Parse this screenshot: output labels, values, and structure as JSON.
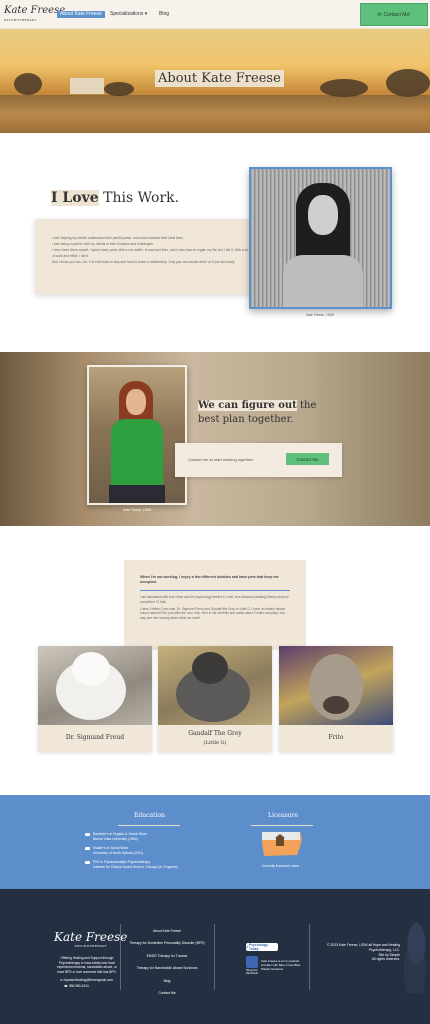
{
  "header": {
    "logo_text": "Kate Freese",
    "logo_sub": "PSYCHOTHERAPY",
    "nav": {
      "about": "About Kate Freese",
      "specializations": "Specializations",
      "blog": "Blog"
    },
    "cta_label": "Contact Me!"
  },
  "hero": {
    "title": "About Kate Freese"
  },
  "love": {
    "title_highlight": "I Love",
    "title_rest": "This Work.",
    "paragraphs": [
      "I love helping my clients understand their painful pasts, and move towards their ideal lives.",
      "I love being a partner with my clients in their triumphs and challenges.",
      "I have been there myself. I spent many years with a non-battle. It was hard then, and it was hard to regain my life, but I did it. With a lot of work and effort, I did it.",
      "And I know you can, too. It is both hard to stay and hard to leave a relationship. Only you can decide when or if you are ready."
    ],
    "photo_caption": "Kate Freese, LISW"
  },
  "plan": {
    "title_highlight": "We can figure out",
    "title_rest": "the best plan together.",
    "contact_prompt": "Contact me to start working together!",
    "button_label": "Contact Me",
    "photo_caption": "Kate Freese, LISW"
  },
  "hobbies": {
    "heading": "When I'm not working, I enjoy a few different hobbies and have pets that keep me occupied.",
    "paragraphs": [
      "I am fascinated with true crime and the psychology behind it. I knit, love diamond painting Disney and just completed 71 Mail.",
      "I have 3 feline Conn cats. Dr. Sigmund Freud and Gandalf the Grey or Little G. I have an elderly basset hound named Frito, just after the corn chip. He's in his old feltie and walks about 2 miles everyday! You may see him moving about while we meet!"
    ],
    "pets": [
      {
        "name": "Dr. Sigmund Freud",
        "sub": ""
      },
      {
        "name": "Gandalf The Grey",
        "sub": "(Little G)"
      },
      {
        "name": "Frito",
        "sub": ""
      }
    ]
  },
  "education": {
    "heading": "Education",
    "items": [
      {
        "line1": "Bachelor's in English & Social Work",
        "line2": "Buena Vista University (1984)"
      },
      {
        "line1": "Master's in Social Work",
        "line2": "University of North Dakota (2021)"
      },
      {
        "line1": "PhD in Psychoanalytic Psychotherapy",
        "line2": "Institute for Clinical Social Work in Chicago (in Progress)"
      }
    ]
  },
  "licensure": {
    "heading": "Licensure",
    "caption": "Currently licensed in Iowa."
  },
  "footer": {
    "logo_text": "Kate Freese",
    "logo_sub": "PSYCHOTHERAPY",
    "description": "Offering Healing and Support through Psychotherapy in Iowa Adults who have experienced trauma, narcissistic abuse, or have BPD or love someone that has BPD.",
    "email": "hopeandhealing@frheesgmail.com",
    "phone": "396-980-4314",
    "links": [
      "About Kate Freese",
      "Therapy for Borderline Personality Disorder (BPD)",
      "EMDR Therapy for Trauma",
      "Therapy for Narcissistic Abuse Survivors",
      "Blog",
      "Contact Me"
    ],
    "badge": "Verified by Psychology Today",
    "badge_short": "Psychology Today",
    "bcbs_caption": "BlueCross BlueShield",
    "bcbs_text": "Kate Freese is an in-network provider with Blue Cross Blue Shield insurance.",
    "copyright": "© 2023 Kate Freese, LISW all Hope and Healing Psychotherapy, LLC.",
    "site_by": "Site by Simple",
    "rights": "All rights reserved."
  },
  "colors": {
    "accent_blue": "#5b92c9",
    "cta_green": "#5fc07d",
    "beige": "#f1e7d9",
    "footer_navy": "#243042"
  }
}
